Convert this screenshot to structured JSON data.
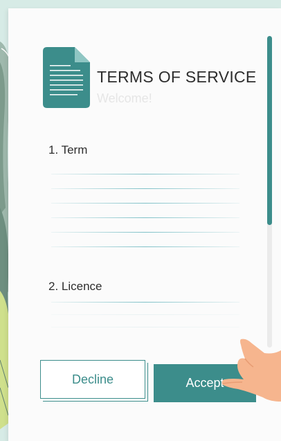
{
  "header": {
    "title": "TERMS OF SERVICE",
    "subtitle": "Welcome!",
    "icon": "document-icon"
  },
  "sections": [
    {
      "heading": "1. Term"
    },
    {
      "heading": "2. Licence"
    }
  ],
  "actions": {
    "decline_label": "Decline",
    "accept_label": "Accept"
  },
  "colors": {
    "accent": "#3c8d8b",
    "background": "#d7ebe6",
    "card": "#fbfbfb",
    "text": "#2d2d2d"
  }
}
